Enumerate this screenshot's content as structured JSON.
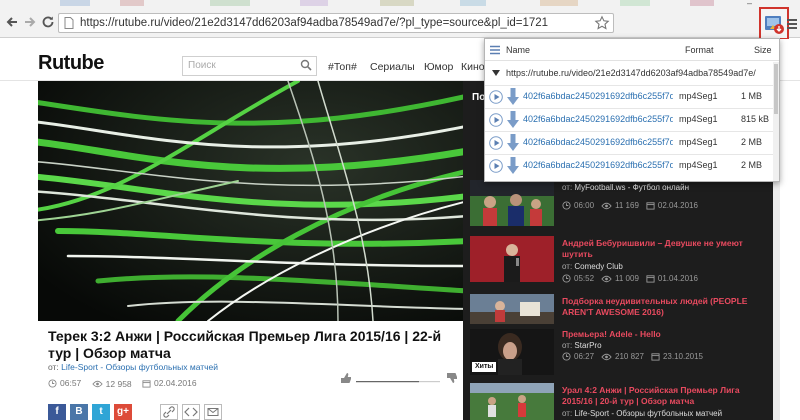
{
  "browser": {
    "url": "https://rutube.ru/video/21e2d3147dd6203af94adba78549ad7e/?pl_type=source&pl_id=1721",
    "minimize_glyph": "–"
  },
  "site": {
    "logo": "Rutube",
    "search_placeholder": "Поиск",
    "nav": [
      "#Топ#",
      "Сериалы",
      "Юмор",
      "Кино"
    ]
  },
  "video": {
    "title": "Терек 3:2 Анжи | Российская Премьер Лига 2015/16 | 22-й тур | Обзор матча",
    "channel_prefix": "от:",
    "channel": "Life-Sport - Обзоры футбольных матчей",
    "duration": "06:57",
    "views": "12 958",
    "date": "02.04.2016",
    "rating": 0.75
  },
  "share": {
    "buttons": [
      {
        "label": "f",
        "color": "#3b5998"
      },
      {
        "label": "B",
        "color": "#4a76a8"
      },
      {
        "label": "t",
        "color": "#2fa5d6"
      },
      {
        "label": "g+",
        "color": "#dd4b39"
      }
    ]
  },
  "sidebar": {
    "header": "По",
    "items": [
      {
        "title": "",
        "channel": "MyFootball.ws - Футбол онлайн",
        "duration": "06:00",
        "views": "11 169",
        "date": "02.04.2016",
        "badge": ""
      },
      {
        "title": "Андрей Бебуришвили – Девушке не умеют шутить",
        "channel": "Comedy Club",
        "duration": "05:52",
        "views": "11 009",
        "date": "01.04.2016",
        "badge": ""
      },
      {
        "title": "Подборка неудивительных людей (PEOPLE AREN'T AWESOME 2016)",
        "channel": "",
        "duration": "",
        "views": "",
        "date": "",
        "badge": ""
      },
      {
        "title": "Премьера! Adele - Hello",
        "channel": "StarPro",
        "duration": "06:27",
        "views": "210 827",
        "date": "23.10.2015",
        "badge": "Хиты"
      },
      {
        "title": "Урал 4:2 Анжи | Российская Премьер Лига 2015/16 | 20-й тур | Обзор матча",
        "channel": "Life-Sport - Обзоры футбольных матчей",
        "duration": "",
        "views": "",
        "date": "",
        "badge": ""
      }
    ],
    "channel_prefix": "от:"
  },
  "popup": {
    "col_name": "Name",
    "col_format": "Format",
    "col_size": "Size",
    "page_url": "https://rutube.ru/video/21e2d3147dd6203af94adba78549ad7e/",
    "rows": [
      {
        "name": "402f6a6bdac2450291692dfb6c255f7d.mp4Seg1-F...",
        "format": "mp4Seg1",
        "size": "1 MB"
      },
      {
        "name": "402f6a6bdac2450291692dfb6c255f7d.mp4Seg1-F...",
        "format": "mp4Seg1",
        "size": "815 kB"
      },
      {
        "name": "402f6a6bdac2450291692dfb6c255f7d.mp4Seg1-F...",
        "format": "mp4Seg1",
        "size": "2 MB"
      },
      {
        "name": "402f6a6bdac2450291692dfb6c255f7d.mp4Seg1-F...",
        "format": "mp4Seg1",
        "size": "2 MB"
      }
    ]
  },
  "colors": {
    "accent_red": "#e84a5f",
    "link_blue": "#2a6fb0",
    "highlight_border": "#d0342c"
  }
}
